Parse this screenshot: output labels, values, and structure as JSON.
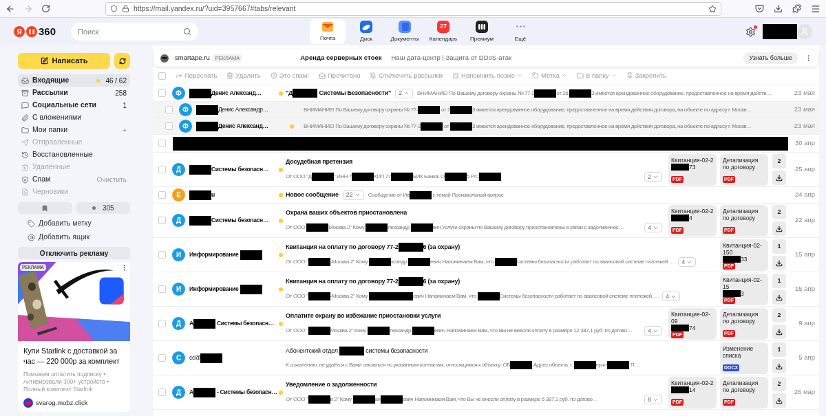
{
  "browser": {
    "url": "https://mail.yandex.ru/?uid=3957667#tabs/relevant"
  },
  "header": {
    "logo_letter": "Я",
    "logo_text": "360",
    "search": {
      "placeholder": "Поиск"
    },
    "nav": [
      {
        "label": "Почта",
        "selected": true
      },
      {
        "label": "Диск",
        "selected": false
      },
      {
        "label": "Документы",
        "selected": false
      },
      {
        "label": "Календарь",
        "selected": false,
        "badge": "27"
      },
      {
        "label": "Премиум",
        "selected": false
      },
      {
        "label": "Ещё",
        "selected": false
      }
    ],
    "settings_notification": true
  },
  "sidebar": {
    "compose": "Написать",
    "folders": [
      {
        "label": "Входящие",
        "count": "46 / 62",
        "selected": true,
        "unread": true,
        "disabled": false,
        "dot": true
      },
      {
        "label": "Рассылки",
        "count": "258",
        "selected": false,
        "unread": true,
        "disabled": false,
        "dot": false
      },
      {
        "label": "Социальные сети",
        "count": "1",
        "selected": false,
        "unread": true,
        "disabled": false,
        "dot": false
      },
      {
        "label": "С вложениями",
        "selected": false,
        "unread": false,
        "disabled": false,
        "dot": false
      },
      {
        "label": "Мои папки",
        "action": "+",
        "selected": false,
        "unread": false,
        "disabled": false,
        "dot": false
      },
      {
        "label": "Отправленные",
        "selected": false,
        "unread": false,
        "disabled": true,
        "dot": false
      },
      {
        "label": "Восстановленные",
        "selected": false,
        "unread": false,
        "disabled": false,
        "dot": false
      },
      {
        "label": "Удалённые",
        "selected": false,
        "unread": false,
        "disabled": true,
        "dot": false
      },
      {
        "label": "Спам",
        "action": "Очистить",
        "selected": false,
        "unread": false,
        "disabled": false,
        "dot": false
      },
      {
        "label": "Черновики",
        "selected": false,
        "unread": false,
        "disabled": true,
        "dot": false
      }
    ],
    "labels_count": "305",
    "links": [
      "Добавить метку",
      "Добавить ящик"
    ],
    "disable_ads": "Отключить рекламу",
    "ad": {
      "badge": "РЕКЛАМА",
      "title": "Купи Starlink с доставкой за час — 220 000р за комплект",
      "bullets": [
        "Поможем оплатить подписку •",
        "Активировали 300+ устройств •",
        "Полный комплект Starlink"
      ],
      "domain": "svarog.mobz.click"
    }
  },
  "top_ad": {
    "domain": "smartape.ru",
    "badge": "РЕКЛАМА",
    "title": "Аренда серверных стоек",
    "text": "Наш дата-центр | Защита от DDoS-атак",
    "button": "Узнать больше"
  },
  "select_all": {
    "checked": false
  },
  "toolbar": [
    {
      "label": "Переслать",
      "disabled": true
    },
    {
      "label": "Удалить",
      "disabled": true
    },
    {
      "label": "Это спам!",
      "disabled": true
    },
    {
      "label": "Прочитано",
      "disabled": true
    },
    {
      "label": "Отключить рассылки",
      "disabled": true
    },
    {
      "label": "Напомнить позже",
      "disabled": true,
      "menu": true
    },
    {
      "label": "Метка",
      "disabled": true,
      "menu": true
    },
    {
      "label": "В папку",
      "disabled": true,
      "menu": true
    },
    {
      "label": "Закрепить",
      "disabled": true
    }
  ],
  "messages": [
    {
      "kind": "thread",
      "checked": false,
      "avatar": "Ф",
      "color": "#1b9ce2",
      "sender": [
        {
          "kind": "redacted"
        },
        "Денис Александ…"
      ],
      "unread": true,
      "dot": true,
      "subject": [
        "\"Д",
        {
          "kind": "redacted"
        },
        " Системы Безопасности\""
      ],
      "count": "2",
      "expanded": true,
      "snippet": [
        "ВНИМАНИЕ! По Вашему договору охраны № 77-2",
        {
          "kind": "redacted"
        },
        "от 26.",
        {
          "kind": "redacted"
        },
        "3 имеется арендованное оборудование, предоставленное на время действ…"
      ],
      "date": "23 мая"
    },
    {
      "kind": "child",
      "checked": false,
      "avatar": "Ф",
      "color": "#1b9ce2",
      "sender": [
        {
          "kind": "redacted"
        },
        "Денис Александр…"
      ],
      "unread": false,
      "dot": false,
      "snippet": [
        "ВНИМАНИЕ! По Вашему договору охраны № 77-",
        {
          "kind": "redacted"
        },
        " от 2",
        {
          "kind": "redacted"
        },
        "3 имеется арендованное оборудование, предоставленное на время действия договора, на объекте по адресу г. Москв…"
      ],
      "date": "23 мая"
    },
    {
      "kind": "child",
      "checked": false,
      "avatar": "Ф",
      "color": "#1b9ce2",
      "sender": [
        {
          "kind": "redacted"
        },
        "Денис Александ…"
      ],
      "unread": true,
      "dot": true,
      "snippet": [
        "ВНИМАНИЕ! По Вашему договору охраны № 77-2",
        {
          "kind": "redacted"
        },
        " от ",
        {
          "kind": "redacted"
        },
        "3 имеется арендованное оборудование, предоставленное на время действия договора, на объекте по адресу г. Москв…"
      ],
      "date": "23 мая"
    },
    {
      "kind": "redacted",
      "checked": false,
      "date": "30 апр"
    },
    {
      "kind": "full",
      "checked": false,
      "avatar": "Д",
      "color": "#1b9ce2",
      "sender": [
        {
          "kind": "redacted"
        },
        "Системы безопасн…"
      ],
      "unread": true,
      "dot": true,
      "subject": [
        "Досудебная претензия"
      ],
      "snippet": [
        "От ООО \"Д",
        {
          "kind": "redacted"
        },
        "\" ИНН 7",
        {
          "kind": "redacted"
        },
        "КПП 77",
        {
          "kind": "redacted"
        },
        "БИК Банка: О",
        {
          "kind": "redacted"
        },
        "5 Р/С",
        {
          "kind": "redacted"
        }
      ],
      "count": "2",
      "expanded": false,
      "attachments": [
        {
          "name": [
            "Квитанция-02-2",
            {
              "kind": "redacted"
            },
            "73"
          ],
          "type": "PDF"
        },
        {
          "name": [
            "Детализация по договору"
          ],
          "type": "PDF"
        }
      ],
      "attach_count": "2",
      "date": "25 апр"
    },
    {
      "kind": "single",
      "checked": false,
      "avatar": "Е",
      "color": "#f5a01a",
      "sender": [
        {
          "kind": "redacted"
        },
        "u"
      ],
      "unread": true,
      "dot": true,
      "subject": [
        "Новое сообщение"
      ],
      "count": "22",
      "expanded": false,
      "snippet": [
        "Сообщение от Ив",
        {
          "kind": "redacted"
        },
        " с темой Произвольный вопрос"
      ],
      "date": "24 апр"
    },
    {
      "kind": "full",
      "checked": false,
      "avatar": "Д",
      "color": "#1b9ce2",
      "sender": [
        {
          "kind": "redacted"
        },
        "Системы безопасн…"
      ],
      "unread": true,
      "dot": true,
      "subject": [
        "Охрана ваших объектов приостановлена"
      ],
      "snippet": [
        "От ООО ",
        {
          "kind": "redacted"
        },
        "Москва 2\" Кому ",
        {
          "kind": "redacted"
        },
        "лександр ",
        {
          "kind": "redacted"
        },
        "вич Услуги охраны по Вашему договору приостановлены в связи с задолженнос…"
      ],
      "count": "4",
      "expanded": false,
      "attachments": [
        {
          "name": [
            "Квитанция-02-2",
            {
              "kind": "redacted"
            },
            "4"
          ],
          "type": "PDF"
        },
        {
          "name": [
            "Детализация по договору"
          ],
          "type": "PDF"
        }
      ],
      "attach_count": "2",
      "date": "22 апр"
    },
    {
      "kind": "full",
      "checked": false,
      "avatar": "И",
      "color": "#1b9ce2",
      "sender": [
        "Информирование ",
        {
          "kind": "redacted"
        }
      ],
      "unread": true,
      "dot": true,
      "subject": [
        "Квитанция на оплату по договору 77-2",
        {
          "kind": "redacted"
        },
        "6 (за охрану)"
      ],
      "snippet": [
        "От ООО \"",
        {
          "kind": "redacted"
        },
        "-Москва 2\" Кому ",
        {
          "kind": "redacted"
        },
        "ксандр ",
        {
          "kind": "redacted"
        },
        "евич Напоминаем Вам, что ",
        {
          "kind": "redacted"
        },
        "системы безопасности работает по авансовой системе платежей. …"
      ],
      "count": "4",
      "expanded": false,
      "attachments": [
        {
          "name": [
            "Квитанция-02-150",
            {
              "kind": "redacted"
            },
            "33"
          ],
          "type": "PDF"
        }
      ],
      "attach_count": "1",
      "date": "15 апр"
    },
    {
      "kind": "full",
      "checked": false,
      "avatar": "И",
      "color": "#1b9ce2",
      "sender": [
        "Информирование ",
        {
          "kind": "redacted"
        }
      ],
      "unread": true,
      "dot": true,
      "subject": [
        "Квитанция на оплату по договору 77-2",
        {
          "kind": "redacted"
        },
        "6 (за охрану)"
      ],
      "snippet": [
        "От ООО \"",
        {
          "kind": "redacted"
        },
        "-Москва 2\" Кому ",
        {
          "kind": "redacted"
        },
        {
          "kind": "redacted"
        },
        "евич Напоминаем Вам, что ",
        {
          "kind": "redacted"
        },
        "Системы безопасности работает по авансовой системе платежей. …"
      ],
      "count": "4",
      "expanded": false,
      "attachments": [
        {
          "name": [
            "Квитанция-02-15",
            {
              "kind": "redacted"
            },
            "3"
          ],
          "type": "PDF"
        }
      ],
      "attach_count": "1",
      "date": "15 апр"
    },
    {
      "kind": "full",
      "checked": false,
      "avatar": "Д",
      "color": "#1b9ce2",
      "sender": [
        "А",
        {
          "kind": "redacted"
        },
        " Системы безопасн…"
      ],
      "unread": true,
      "dot": true,
      "subject": [
        "Оплатите охрану во избежание приостановки услуги"
      ],
      "snippet": [
        "От ООО \"",
        {
          "kind": "redacted"
        },
        "Москва 2\" Кому ",
        {
          "kind": "redacted"
        },
        "лександр ",
        {
          "kind": "redacted"
        },
        "евич Напоминаем Вам, что Вы не внесли оплату в размере 12 387,1 руб. по догово…"
      ],
      "count": "4",
      "expanded": false,
      "attachments": [
        {
          "name": [
            "Квитанция-02-09",
            {
              "kind": "redacted"
            },
            "74"
          ],
          "type": "PDF"
        },
        {
          "name": [
            "Детализация по договору"
          ],
          "type": "PDF"
        }
      ],
      "attach_count": "2",
      "date": "9 апр"
    },
    {
      "kind": "full",
      "checked": false,
      "avatar": "С",
      "color": "#1b9ce2",
      "sender": [
        "cc@",
        {
          "kind": "redacted"
        }
      ],
      "unread": false,
      "dot": false,
      "subject": [
        "Абонентский отдел ",
        {
          "kind": "redacted"
        },
        " системы безопасности"
      ],
      "snippet": [
        "К сожалению, не удаётся с Вами связаться по указанным контактам, относящимся к объекту: ОБ",
        {
          "kind": "redacted"
        },
        " Адрес объекта: г. ",
        {
          "kind": "redacted"
        },
        "пр-кт",
        {
          "kind": "redacted"
        },
        " П…"
      ],
      "attachments": [
        {
          "name": [
            "Изменение списка"
          ],
          "type": "DOCX"
        }
      ],
      "attach_count": "1",
      "date": "5 апр"
    },
    {
      "kind": "full",
      "checked": false,
      "avatar": "Д",
      "color": "#1b9ce2",
      "sender": [
        "А",
        {
          "kind": "redacted"
        },
        " - Системы безопасн…"
      ],
      "unread": true,
      "dot": true,
      "subject": [
        "Уведомление о задолженности"
      ],
      "snippet": [
        "От ООО \"",
        {
          "kind": "redacted"
        },
        "в 2\" Кому ",
        {
          "kind": "redacted"
        },
        "ан",
        {
          "kind": "redacted"
        },
        "евич Напоминаем Вам, что Вы не внесли оплату в размере 6 387,1 руб. по догово…"
      ],
      "count": "8",
      "expanded": false,
      "attachments": [
        {
          "name": [
            "Квитанция-02-2",
            {
              "kind": "redacted"
            },
            "14"
          ],
          "type": "PDF"
        },
        {
          "name": [
            "Детализация по договору"
          ],
          "type": "PDF"
        }
      ],
      "attach_count": "2",
      "date": "26 мар"
    }
  ]
}
